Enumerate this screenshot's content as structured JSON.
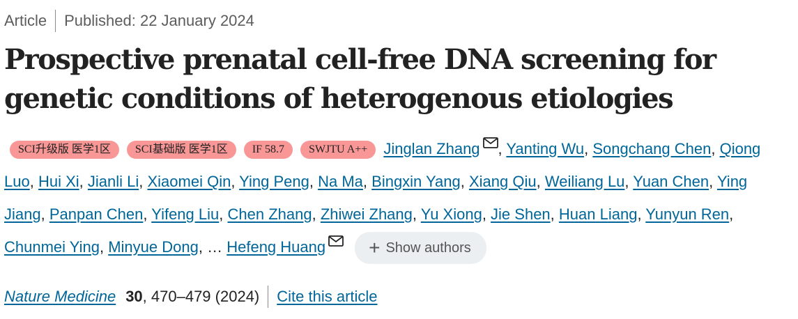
{
  "meta": {
    "type": "Article",
    "published": "Published: 22 January 2024"
  },
  "title": "Prospective prenatal cell-free DNA screening for genetic conditions of heterogenous etiologies",
  "badges": [
    "SCI升级版 医学1区",
    "SCI基础版 医学1区",
    "IF 58.7",
    "SWJTU A++"
  ],
  "authors": [
    "Jinglan Zhang",
    "Yanting Wu",
    "Songchang Chen",
    "Qiong Luo",
    "Hui Xi",
    "Jianli Li",
    "Xiaomei Qin",
    "Ying Peng",
    "Na Ma",
    "Bingxin Yang",
    "Xiang Qiu",
    "Weiliang Lu",
    "Yuan Chen",
    "Ying Jiang",
    "Panpan Chen",
    "Yifeng Liu",
    "Chen Zhang",
    "Zhiwei Zhang",
    "Yu Xiong",
    "Jie Shen",
    "Huan Liang",
    "Yunyun Ren",
    "Chunmei Ying",
    "Minyue Dong"
  ],
  "last_author": "Hefeng Huang",
  "ellipsis": "…",
  "show_authors": {
    "icon": "plus-icon",
    "label": "Show authors"
  },
  "citation": {
    "journal": "Nature Medicine",
    "volume": "30",
    "pages": ", 470–479 (2024)",
    "cite_link": "Cite this article"
  },
  "colors": {
    "link": "#006699",
    "badge": "#f99696",
    "button_bg": "#eceff1"
  }
}
